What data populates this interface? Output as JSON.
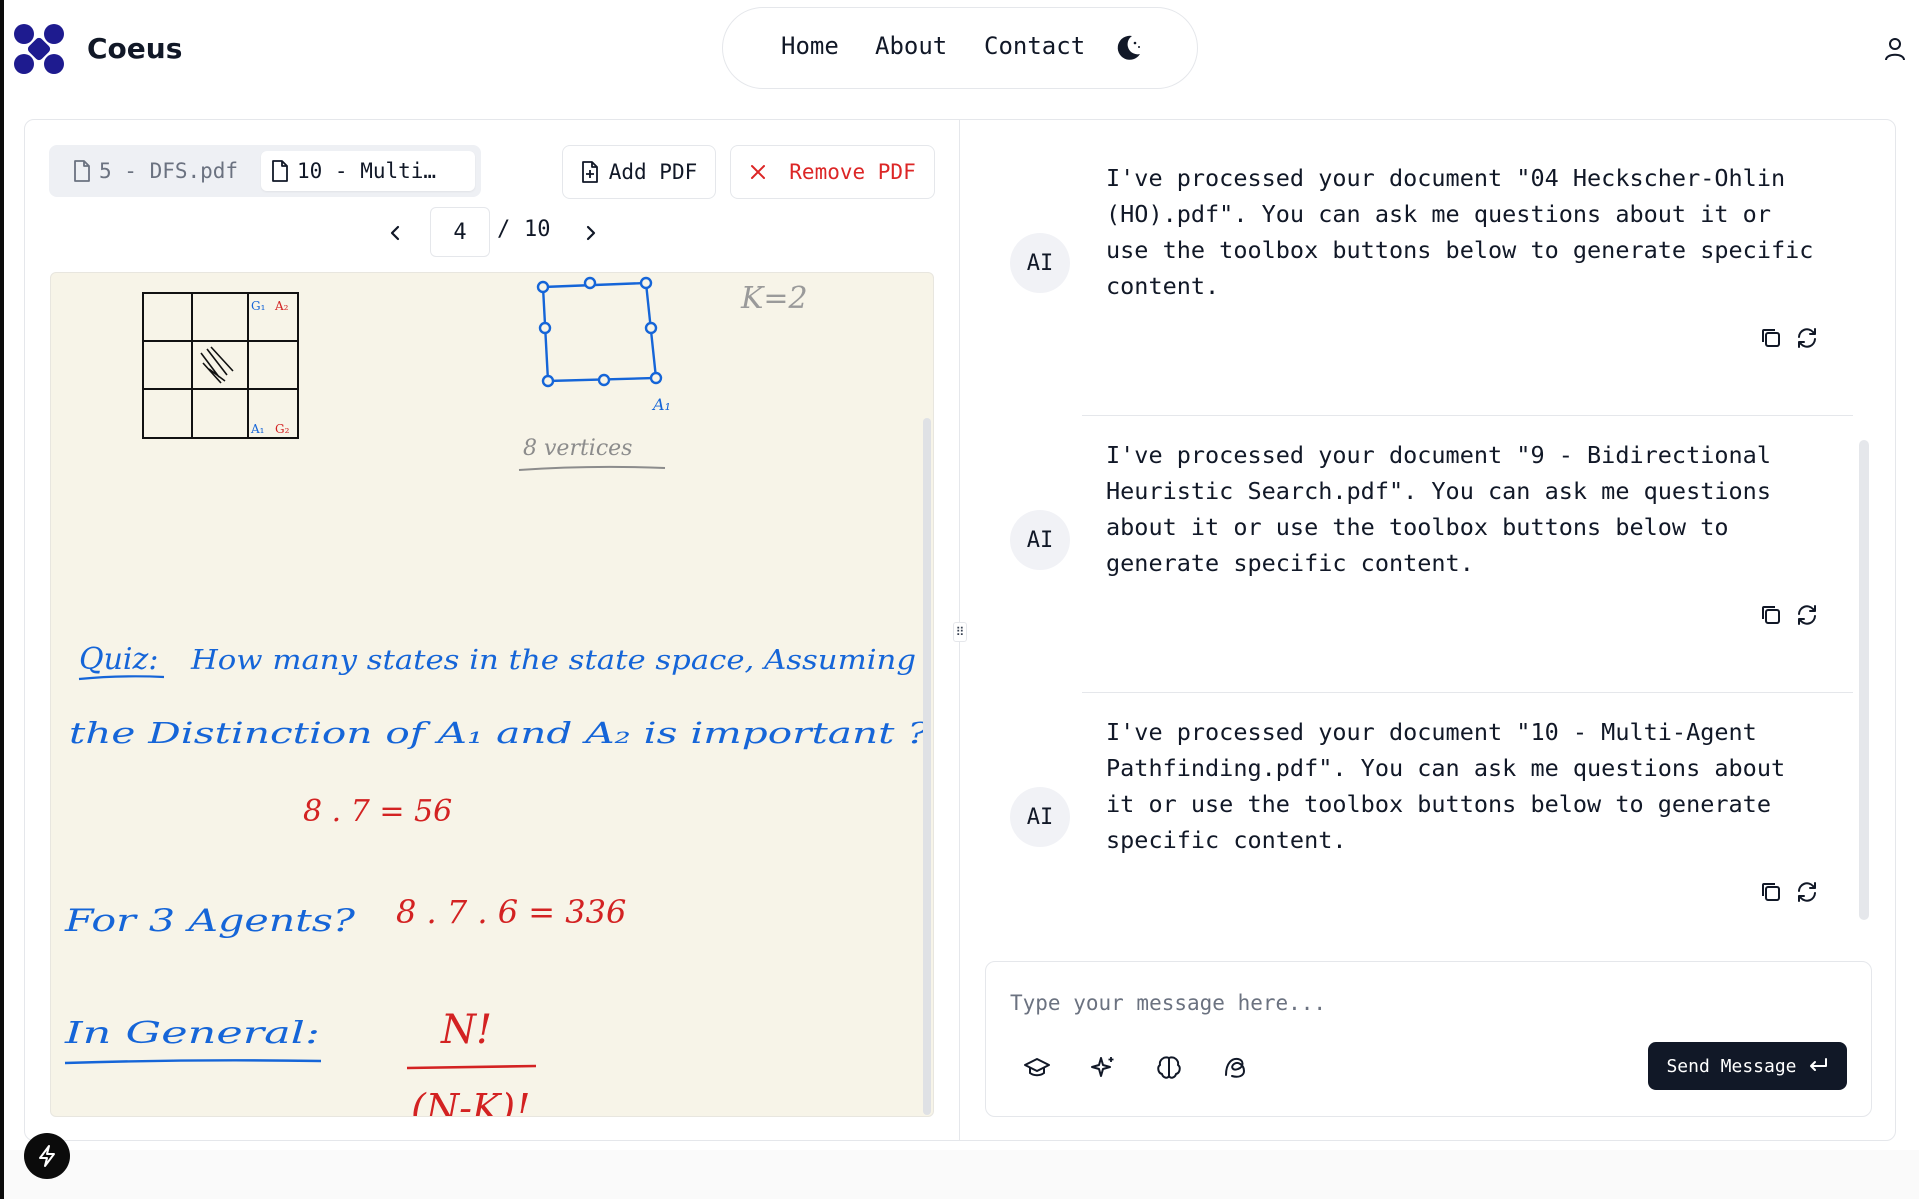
{
  "app": {
    "name": "Coeus",
    "accent": "#1e1b8f"
  },
  "nav": {
    "home": "Home",
    "about": "About",
    "contact": "Contact",
    "theme_icon": "moon-icon",
    "user_icon": "user-icon"
  },
  "pdf": {
    "tabs": [
      {
        "label": "5 - DFS.pdf",
        "active": false
      },
      {
        "label": "10 - Multi…",
        "active": true
      }
    ],
    "add_label": "Add PDF",
    "remove_label": "Remove PDF",
    "current_page": "4",
    "page_separator": "/",
    "total_pages": "10"
  },
  "viewer": {
    "grid_label_top_left": "G₁",
    "grid_label_top_right": "A₂",
    "grid_label_bottom_left": "A₁",
    "grid_label_bottom_right": "G₂",
    "k_label": "K=2",
    "square_label": "A₁",
    "vertices_label": "8 vertices",
    "quiz_label": "Quiz:",
    "quiz_text_line1": "How many states in the state space, Assuming",
    "quiz_text_line2": "the Distinction of A₁ and A₂ is important ?",
    "answer1": "8 . 7 = 56",
    "three_agents": "For 3 Agents?",
    "answer2": "8 . 7 . 6 = 336",
    "in_general": "In General:",
    "formula_num": "N!",
    "formula_den": "(N-K)!"
  },
  "chat": {
    "avatar_label": "AI",
    "messages": [
      {
        "text": "I've processed your document \"04 Heckscher-Ohlin (HO).pdf\". You can ask me questions about it or use the toolbox buttons below to generate specific content."
      },
      {
        "text": "I've processed your document \"9 - Bidirectional Heuristic Search.pdf\". You can ask me questions about it or use the toolbox buttons below to generate specific content."
      },
      {
        "text": "I've processed your document \"10 - Multi-Agent Pathfinding.pdf\". You can ask me questions about it or use the toolbox buttons below to generate specific content."
      }
    ],
    "input_placeholder": "Type your message here...",
    "send_label": "Send Message",
    "tools": [
      "graduation-cap-icon",
      "sparkles-icon",
      "brain-icon",
      "mind-map-icon"
    ]
  },
  "colors": {
    "ink_blue": "#1565d8",
    "ink_red": "#d32222",
    "danger": "#dc2626",
    "send_bg": "#111827",
    "paper": "#f7f4e8"
  }
}
